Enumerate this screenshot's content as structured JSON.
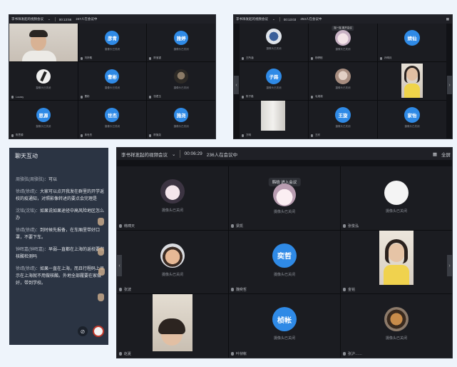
{
  "win1": {
    "title": "李书祥发起的视频会议",
    "timer": "00:13:56",
    "count": "247人在会议中",
    "tiles": [
      {
        "name": "",
        "type": "video"
      },
      {
        "name": "刘婷素",
        "type": "circle",
        "label": "彦青",
        "cam": "摄像头已关闭"
      },
      {
        "name": "陈宝银",
        "type": "circle",
        "label": "雅婷",
        "cam": "摄像头已关闭"
      },
      {
        "name": "Lucasy",
        "type": "photo",
        "cam": "摄像头已关闭"
      },
      {
        "name": "曹彬",
        "type": "circle",
        "label": "曹彬",
        "cam": "摄像头已关闭"
      },
      {
        "name": "张君玉",
        "type": "photo",
        "cam": "摄像头已关闭"
      },
      {
        "name": "陈思源",
        "type": "circle",
        "label": "思源",
        "cam": "摄像头已关闭"
      },
      {
        "name": "朱世杰",
        "type": "circle",
        "label": "世杰",
        "cam": "摄像头已关闭"
      },
      {
        "name": "陈施尧",
        "type": "circle",
        "label": "施尧",
        "cam": "摄像头已关闭"
      }
    ]
  },
  "win2": {
    "title": "李书祥发起的视频会议",
    "timer": "00:13:03",
    "count": "253人在会议中",
    "tiles": [
      {
        "name": "王所涵",
        "type": "photo",
        "cam": "摄像头已关闭"
      },
      {
        "name": "杨骋程",
        "type": "photo",
        "cam": "摄像头已关闭",
        "badge": "摇一摇 离开会议"
      },
      {
        "name": "孙明月",
        "type": "circle",
        "label": "婧仙",
        "cam": ""
      },
      {
        "name": "陈子路",
        "type": "circle",
        "label": "子路",
        "cam": "摄像头已关闭"
      },
      {
        "name": "毛湘湘",
        "type": "photo",
        "cam": "摄像头已关闭"
      },
      {
        "name": "",
        "type": "video"
      },
      {
        "name": "方明",
        "type": "video"
      },
      {
        "name": "王欣",
        "type": "circle",
        "label": "王旋",
        "cam": "摄像头已关闭"
      },
      {
        "name": "家怡",
        "type": "circle",
        "label": "家怡",
        "cam": "摄像头已关闭"
      }
    ]
  },
  "chat": {
    "title": "聊天互动",
    "messages": [
      {
        "who": "周骆弦(周骆弦)：",
        "text": "可以"
      },
      {
        "who": "徐靖(徐靖)：",
        "text": "大家可以点开我发在群里的开学返校的疫通知，对照影像转述的要点会完理是"
      },
      {
        "who": "沈铭(沈铭)：",
        "text": "如果说如果途径中高风险地区怎么办"
      },
      {
        "who": "徐靖(徐靖)：",
        "text": "到时候先报备，在车厢里带好口罩，不要下车。"
      },
      {
        "who": "钟晖嘉(钟晖嘉)：",
        "text": "早弱—直都在上海的返校要做核酸检测吗"
      },
      {
        "who": "徐靖(徐靖)：",
        "text": "如果一直在上海，而且行程码上显示在上海就不用做核酸。外地全部履要在家做好，带到学校。"
      }
    ]
  },
  "win3": {
    "title": "李书祥发起的视频会议",
    "timer": "00:06:29",
    "count": "236人在会议中",
    "fullscreen": "全屏",
    "tiles": [
      {
        "name": "韩啸天",
        "type": "photo",
        "cam": "摄像头已关闭"
      },
      {
        "name": "梁凯",
        "type": "photo",
        "cam": "摄像头已关闭",
        "badge": "韩晗 进入会议"
      },
      {
        "name": "张俊泓",
        "type": "white",
        "cam": "摄像头已关闭"
      },
      {
        "name": "张波",
        "type": "photo",
        "cam": "摄像头已关闭"
      },
      {
        "name": "魏奕哲",
        "type": "circle",
        "label": "奕哲",
        "cam": "摄像头已关闭"
      },
      {
        "name": "金铭",
        "type": "video"
      },
      {
        "name": "赵夏",
        "type": "video"
      },
      {
        "name": "叶桢帐",
        "type": "circle",
        "label": "桢帐",
        "cam": "摄像头已关闭"
      },
      {
        "name": "张沪……",
        "type": "photo",
        "cam": "摄像头已关闭"
      }
    ]
  }
}
